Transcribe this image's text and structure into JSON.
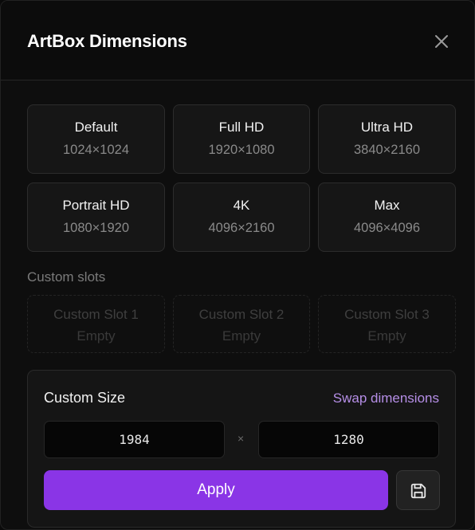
{
  "dialog": {
    "title": "ArtBox Dimensions",
    "close_icon": "close-icon"
  },
  "presets": [
    {
      "name": "Default",
      "dims": "1024×1024"
    },
    {
      "name": "Full HD",
      "dims": "1920×1080"
    },
    {
      "name": "Ultra HD",
      "dims": "3840×2160"
    },
    {
      "name": "Portrait HD",
      "dims": "1080×1920"
    },
    {
      "name": "4K",
      "dims": "4096×2160"
    },
    {
      "name": "Max",
      "dims": "4096×4096"
    }
  ],
  "custom_slots": {
    "label": "Custom slots",
    "slots": [
      {
        "name": "Custom Slot 1",
        "value": "Empty"
      },
      {
        "name": "Custom Slot 2",
        "value": "Empty"
      },
      {
        "name": "Custom Slot 3",
        "value": "Empty"
      }
    ]
  },
  "custom_size": {
    "title": "Custom Size",
    "swap_label": "Swap dimensions",
    "width": "1984",
    "height": "1280",
    "separator": "×",
    "apply_label": "Apply",
    "save_icon": "save-icon"
  },
  "colors": {
    "accent": "#8a35e6",
    "link": "#b58ee6",
    "background": "#0e0e0e"
  }
}
